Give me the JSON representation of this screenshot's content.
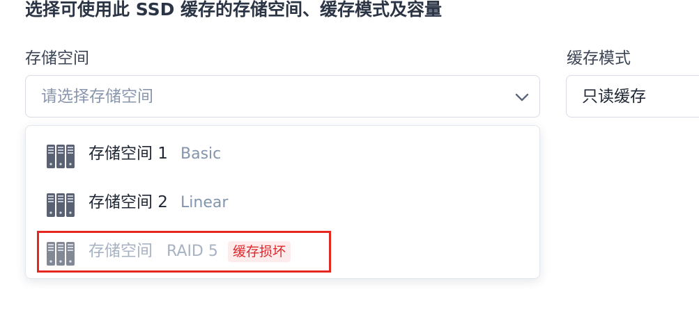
{
  "heading": "选择可使用此 SSD 缓存的存储空间、缓存模式及容量",
  "storage_field": {
    "label": "存储空间",
    "placeholder": "请选择存储空间"
  },
  "mode_field": {
    "label": "缓存模式",
    "value": "只读缓存"
  },
  "dropdown": {
    "options": [
      {
        "name": "存储空间 1",
        "type": "Basic",
        "icon": "server-rack-icon"
      },
      {
        "name": "存储空间 2",
        "type": "Linear",
        "icon": "server-rack-icon"
      },
      {
        "name": "存储空间",
        "type": "RAID 5",
        "icon": "server-rack-icon",
        "badge": "缓存损坏",
        "disabled": true
      }
    ]
  },
  "colors": {
    "badge_text": "#e0252b",
    "badge_bg": "#fdeceb",
    "highlight_border": "#e4281f",
    "placeholder_text": "#8996ad"
  }
}
